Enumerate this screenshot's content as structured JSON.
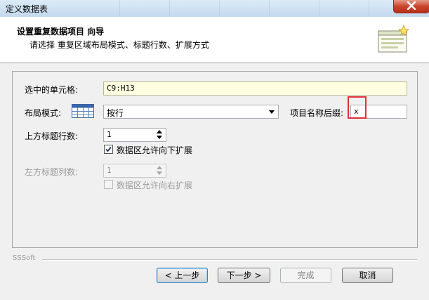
{
  "window": {
    "title": "定义数据表"
  },
  "header": {
    "title": "设置重复数据项目 向导",
    "subtitle": "请选择 重复区域布局模式、标题行数、扩展方式"
  },
  "form": {
    "cell_label": "选中的单元格:",
    "cell_value": "C9:H13",
    "layout_label": "布局模式:",
    "layout_value": "按行",
    "suffix_label": "项目名称后缀:",
    "suffix_value": "x",
    "top_rows_label": "上方标题行数:",
    "top_rows_value": "1",
    "expand_down_label": "数据区允许向下扩展",
    "expand_down_checked": true,
    "left_cols_label": "左方标题列数:",
    "left_cols_value": "1",
    "expand_right_label": "数据区允许向右扩展",
    "expand_right_checked": false
  },
  "footer": {
    "brand": "SSSoft",
    "prev_label": "< 上一步",
    "next_label": "下一步 >",
    "finish_label": "完成",
    "cancel_label": "取消"
  },
  "colors": {
    "highlight": "#e0303a",
    "cell_field_bg": "#ffffe1",
    "titlebar": "#c4d9ee"
  }
}
